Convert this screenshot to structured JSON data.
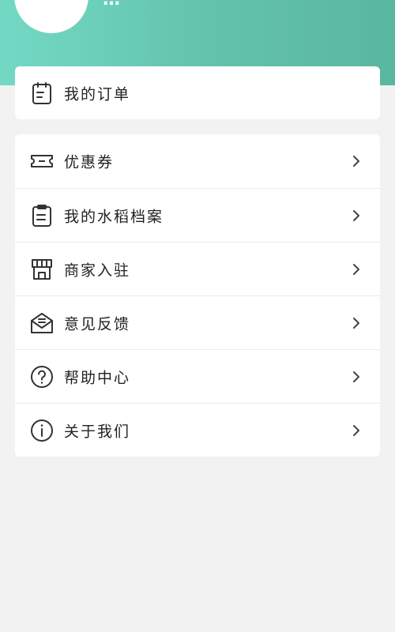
{
  "user": {
    "name": "…"
  },
  "orders": {
    "label": "我的订单",
    "icon": "order-clipboard-icon"
  },
  "menu": {
    "items": [
      {
        "label": "优惠券",
        "icon": "coupon-icon"
      },
      {
        "label": "我的水稻档案",
        "icon": "archive-clipboard-icon"
      },
      {
        "label": "商家入驻",
        "icon": "storefront-icon"
      },
      {
        "label": "意见反馈",
        "icon": "feedback-envelope-icon"
      },
      {
        "label": "帮助中心",
        "icon": "help-question-icon"
      },
      {
        "label": "关于我们",
        "icon": "info-icon"
      }
    ]
  },
  "colors": {
    "header_start": "#73d9c4",
    "header_end": "#5ab79f",
    "text": "#222222",
    "icon": "#333333"
  }
}
